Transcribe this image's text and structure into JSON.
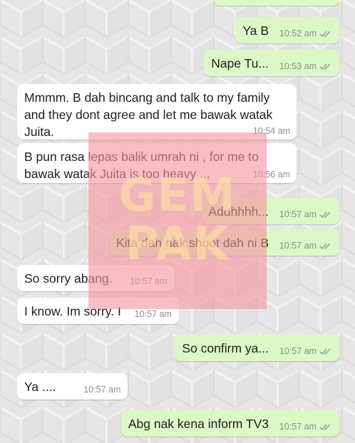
{
  "colors": {
    "outgoing_bubble": "#dcf8c6",
    "incoming_bubble": "#ffffff",
    "timestamp": "#8a8f8c",
    "watermark": "#f696a0"
  },
  "watermark": {
    "line1": "GEM",
    "line2": "PAK"
  },
  "messages": [
    {
      "direction": "out",
      "text": "Ya B",
      "time": "10:52 am",
      "status": "read"
    },
    {
      "direction": "out",
      "text": "Nape Tu...",
      "time": "10:53 am",
      "status": "read"
    },
    {
      "direction": "in",
      "text": "Mmmm. B dah bincang and talk to my family and they dont agree and let me bawak watak Juita.",
      "time": "10:54 am"
    },
    {
      "direction": "in",
      "text": "B pun rasa lepas balik umrah ni , for me to bawak watak Juita is too heavy ...",
      "time": "10:56 am"
    },
    {
      "direction": "out",
      "text": "Aduhhhh...",
      "time": "10:57 am",
      "status": "read"
    },
    {
      "direction": "out",
      "text": "Kita dah nak shoot dah ni B",
      "time": "10:57 am",
      "status": "read"
    },
    {
      "direction": "in",
      "text": "So sorry abang.",
      "time": "10:57 am"
    },
    {
      "direction": "in",
      "text": "I know. Im sorry. I",
      "time": "10:57 am"
    },
    {
      "direction": "out",
      "text": "So confirm ya...",
      "time": "10:57 am",
      "status": "read"
    },
    {
      "direction": "in",
      "text": "Ya ....",
      "time": "10:57 am"
    },
    {
      "direction": "out",
      "text": "Abg nak kena inform TV3",
      "time": "10:57 am",
      "status": "read"
    }
  ]
}
